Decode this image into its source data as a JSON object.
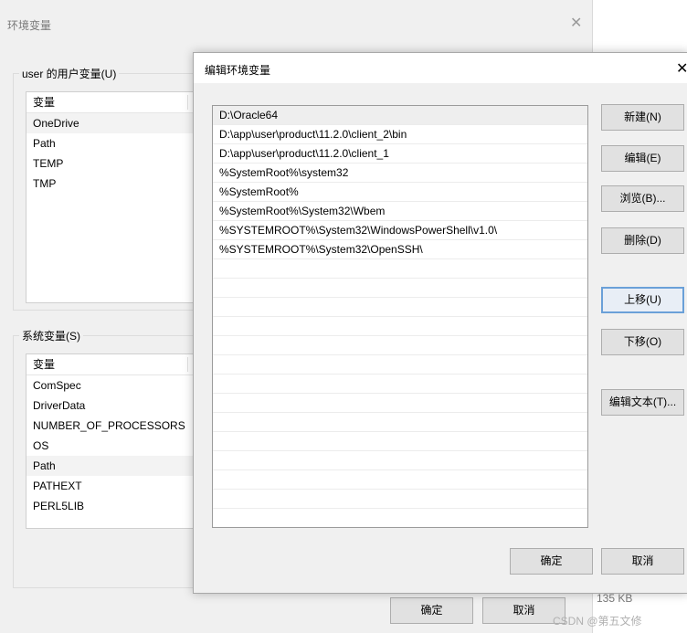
{
  "background_window": {
    "title": "环境变量",
    "close_glyph": "✕",
    "user_vars": {
      "group_label": "user 的用户变量(U)",
      "header": "变量",
      "items": [
        "OneDrive",
        "Path",
        "TEMP",
        "TMP"
      ],
      "selected_index": 0
    },
    "system_vars": {
      "group_label": "系统变量(S)",
      "header": "变量",
      "items": [
        "ComSpec",
        "DriverData",
        "NUMBER_OF_PROCESSORS",
        "OS",
        "Path",
        "PATHEXT",
        "PERL5LIB"
      ],
      "selected_index": 4
    },
    "ok_label": "确定",
    "cancel_label": "取消"
  },
  "dialog": {
    "title": "编辑环境变量",
    "close_glyph": "✕",
    "paths": [
      "D:\\Oracle64",
      "D:\\app\\user\\product\\11.2.0\\client_2\\bin",
      "D:\\app\\user\\product\\11.2.0\\client_1",
      "%SystemRoot%\\system32",
      "%SystemRoot%",
      "%SystemRoot%\\System32\\Wbem",
      "%SYSTEMROOT%\\System32\\WindowsPowerShell\\v1.0\\",
      "%SYSTEMROOT%\\System32\\OpenSSH\\"
    ],
    "selected_index": 0,
    "empty_rows": 13,
    "buttons": {
      "new": "新建(N)",
      "edit": "编辑(E)",
      "browse": "浏览(B)...",
      "delete": "删除(D)",
      "move_up": "上移(U)",
      "move_down": "下移(O)",
      "edit_text": "编辑文本(T)..."
    },
    "ok_label": "确定",
    "cancel_label": "取消"
  },
  "file_size": "135 KB",
  "watermark": "CSDN @第五文修"
}
